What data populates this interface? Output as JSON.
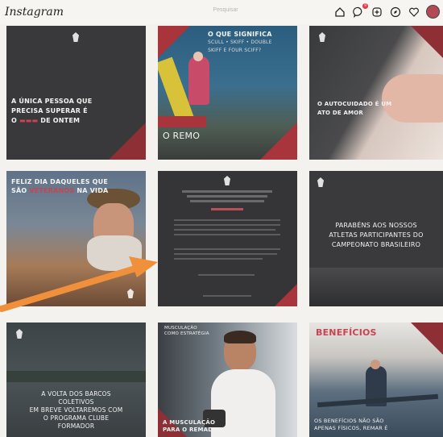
{
  "header": {
    "logo_text": "Instagram",
    "search_placeholder": "Pesquisar"
  },
  "nav": {
    "notification_count": "9"
  },
  "posts": [
    {
      "line1": "A ÚNICA PESSOA QUE",
      "line2": "PRECISA SUPERAR É",
      "line3a": "O",
      "line3b": "DE ONTEM"
    },
    {
      "title1": "O QUE SIGNIFICA",
      "title2": "SCULL • SKIFF • DOUBLE",
      "title3": "SKIFF E FOUR SCIFF?",
      "caption": "O REMO"
    },
    {
      "line1": "O AUTOCUIDADO É UM",
      "line2": "ATO DE AMOR"
    },
    {
      "line1a": "FELIZ DIA DAQUELES QUE",
      "line2a": "SÃO",
      "line2b": "VETERANOS",
      "line2c": "NA VIDA"
    },
    {
      "line1": "PARABÉNS AOS NOSSOS",
      "line2": "ATLETAS PARTICIPANTES DO",
      "line3": "CAMPEONATO BRASILEIRO"
    },
    {
      "line1": "A VOLTA DOS BARCOS",
      "line2": "COLETIVOS",
      "line3": "EM BREVE VOLTAREMOS COM",
      "line4": "O PROGRAMA CLUBE",
      "line5": "FORMADOR"
    },
    {
      "tag": "MUSCULAÇÃO COMO ESTRATÉGIA",
      "line1": "A MUSCULAÇÃO",
      "line2": "PARA O REMADOR"
    },
    {
      "title": "BENEFÍCIOS",
      "line1": "OS BENEFÍCIOS NÃO SÃO",
      "line2": "APENAS FÍSICOS, REMAR É"
    }
  ],
  "colors": {
    "accent_red": "#a8353c",
    "annotation_arrow": "#f0903a"
  }
}
